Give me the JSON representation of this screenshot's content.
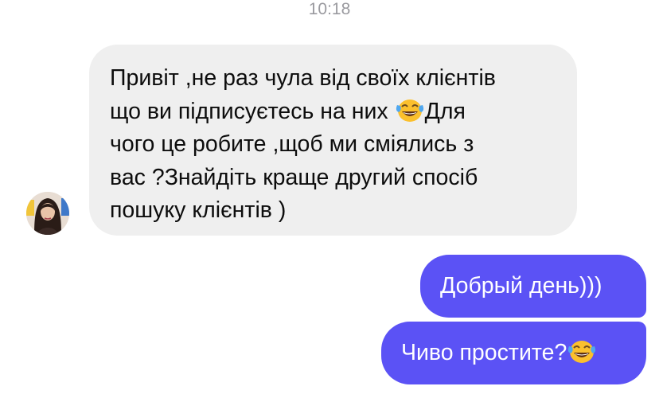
{
  "timestamp": "10:18",
  "incoming_message": {
    "avatar": "profile-photo-woman",
    "lines": [
      "Привіт ,не раз чула від своїх клієнтів",
      "що ви підписуєтесь на них ",
      "Для",
      "чого це робите ,щоб ми сміялись з",
      "вас ?Знайдіть краще другий спосіб",
      "пошуку клієнтів )"
    ],
    "emoji": "face-with-tears-of-joy-emoji"
  },
  "outgoing_messages": [
    {
      "text": "Добрый день)))"
    },
    {
      "text": "Чиво простите?",
      "emoji": "face-with-tears-of-joy-emoji"
    }
  ],
  "colors": {
    "incoming_bubble": "#efefef",
    "outgoing_bubble": "#5b52f5",
    "timestamp": "#9a9a9f"
  }
}
